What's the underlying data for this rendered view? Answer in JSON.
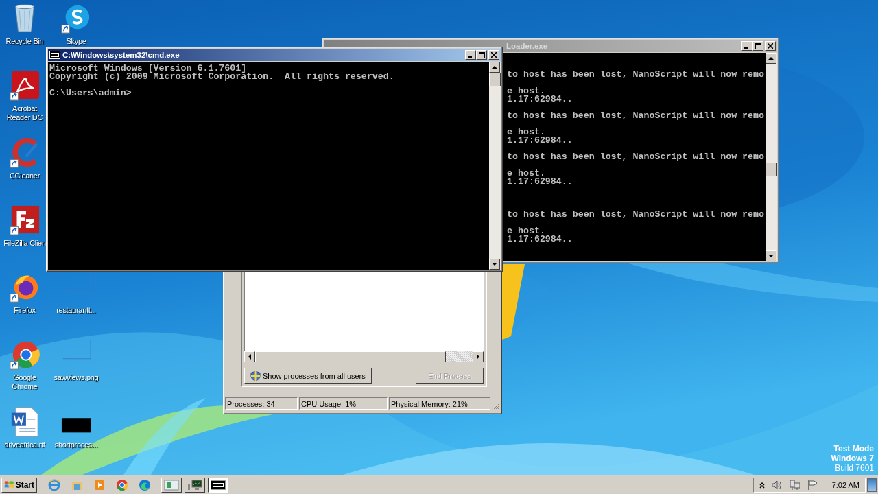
{
  "desktop_icons": [
    {
      "label": "Recycle Bin",
      "kind": "recycle",
      "shortcut": false
    },
    {
      "label": "Acrobat Reader DC",
      "kind": "acrobat",
      "shortcut": true
    },
    {
      "label": "CCleaner",
      "kind": "ccleaner",
      "shortcut": true
    },
    {
      "label": "FileZilla Clien",
      "kind": "filezilla",
      "shortcut": true
    },
    {
      "label": "Firefox",
      "kind": "firefox",
      "shortcut": true
    },
    {
      "label": "Google Chrome",
      "kind": "chrome",
      "shortcut": true
    },
    {
      "label": "driveafrica.rtf",
      "kind": "word",
      "shortcut": false
    },
    {
      "label": "Skype",
      "kind": "skype",
      "shortcut": true
    },
    {
      "label": "restaurantt...",
      "kind": "blank",
      "shortcut": false
    },
    {
      "label": "sawviews.png",
      "kind": "blank",
      "shortcut": false
    },
    {
      "label": "shortproces...",
      "kind": "black",
      "shortcut": false
    }
  ],
  "loader_window": {
    "title": "Loader.exe",
    "blocks": [
      {
        "message": "to host has been lost, NanoScript will now remo",
        "host": "e host.",
        "address": "1.17:62984.."
      },
      {
        "message": "to host has been lost, NanoScript will now remo",
        "host": "e host.",
        "address": "1.17:62984.."
      },
      {
        "message": "to host has been lost, NanoScript will now remo",
        "host": "e host.",
        "address": "1.17:62984.."
      },
      {
        "message": "to host has been lost, NanoScript will now remo",
        "host": "e host.",
        "address": "1.17:62984.."
      }
    ]
  },
  "cmd_window": {
    "title": "C:\\Windows\\system32\\cmd.exe",
    "lines": [
      "Microsoft Windows [Version 6.1.7601]",
      "Copyright (c) 2009 Microsoft Corporation.  All rights reserved.",
      "C:\\Users\\admin>"
    ]
  },
  "task_manager": {
    "buttons": [
      {
        "label": "Show processes from all users",
        "disabled": false
      },
      {
        "label": "End Process",
        "disabled": true
      }
    ],
    "status_bar": [
      "Processes: 34",
      "CPU Usage: 1%",
      "Physical Memory: 21%"
    ]
  },
  "system_info": [
    "Test Mode",
    "Windows 7",
    "Build 7601"
  ],
  "taskbar": {
    "start": "Start",
    "quick_launch": [
      {
        "kind": "ie"
      },
      {
        "kind": "folder"
      },
      {
        "kind": "media"
      },
      {
        "kind": "chrome"
      },
      {
        "kind": "edge"
      }
    ],
    "tasks": [
      {
        "kind": "window",
        "selected": false
      },
      {
        "kind": "monitor",
        "selected": false
      },
      {
        "kind": "cmd",
        "selected": true
      }
    ],
    "clock": "7:02 AM"
  }
}
